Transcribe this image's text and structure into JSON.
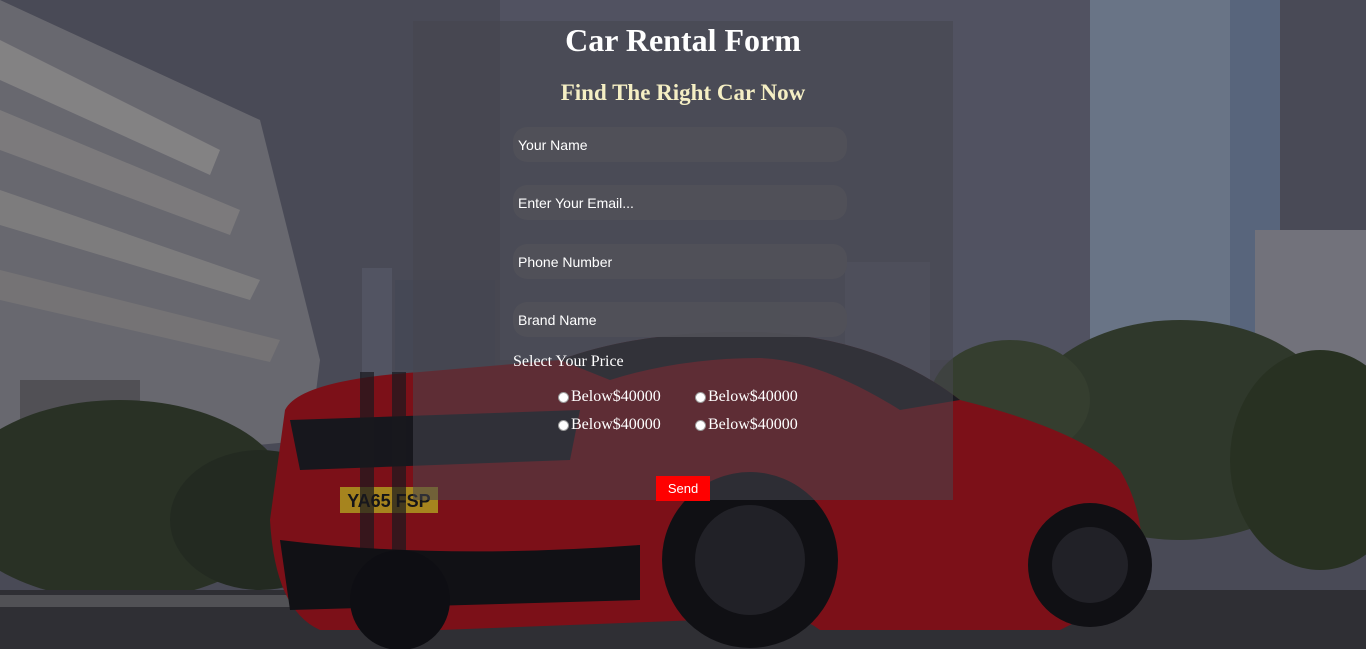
{
  "colors": {
    "panel_background": "#46464e",
    "title_color": "#ffffff",
    "subtitle_color": "#f5efc4",
    "send_button": "#ff0000",
    "car_body": "#b01518"
  },
  "form": {
    "title": "Car Rental Form",
    "subtitle": "Find The Right Car Now",
    "fields": {
      "name_placeholder": "Your Name",
      "email_placeholder": "Enter Your Email...",
      "phone_placeholder": "Phone Number",
      "brand_placeholder": "Brand Name"
    },
    "price_label": "Select Your Price",
    "price_options": [
      "Below$40000",
      "Below$40000",
      "Below$40000",
      "Below$40000"
    ],
    "send_label": "Send"
  },
  "background": {
    "license_plate": "YA65 FSP"
  }
}
